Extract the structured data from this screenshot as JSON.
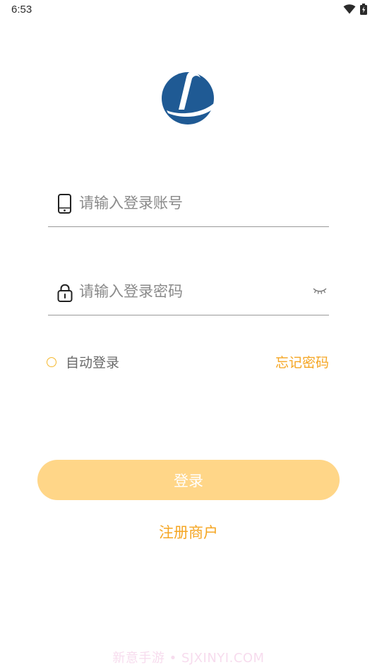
{
  "status_bar": {
    "time": "6:53",
    "icons": [
      "wifi-icon",
      "battery-icon"
    ]
  },
  "logo": {
    "icon": "brand-logo-icon",
    "color": "#1f5a94"
  },
  "account_field": {
    "icon": "phone-icon",
    "placeholder": "请输入登录账号",
    "value": ""
  },
  "password_field": {
    "icon": "lock-icon",
    "placeholder": "请输入登录密码",
    "value": "",
    "toggle_icon": "eye-closed-icon"
  },
  "auto_login": {
    "label": "自动登录",
    "checked": false
  },
  "forgot_password": {
    "label": "忘记密码"
  },
  "login_button": {
    "label": "登录",
    "color": "#ffd688"
  },
  "register": {
    "label": "注册商户"
  },
  "watermark": {
    "text": "新意手游 • SJXINYI.COM"
  },
  "colors": {
    "accent": "#f5a623",
    "radio": "#f5b82e",
    "divider": "#9a9a9a"
  }
}
